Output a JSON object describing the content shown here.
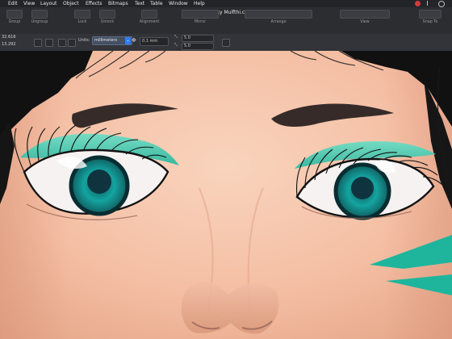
{
  "menubar": {
    "items": [
      "Edit",
      "View",
      "Layout",
      "Object",
      "Effects",
      "Bitmaps",
      "Text",
      "Table",
      "Window",
      "Help"
    ]
  },
  "window": {
    "title": "Zaky Mulfthi.cdr"
  },
  "toolbar": {
    "groups": [
      "Group",
      "Ungroup",
      "Lock",
      "Unlock",
      "Alignment",
      "Mirror",
      "Arrange",
      "View",
      "Snap To"
    ]
  },
  "propbar": {
    "x_coord": "32.616",
    "y_coord": "13.292",
    "units_label": "Units:",
    "units_value": "millimeters",
    "nudge_value": "0.1 mm",
    "dup_x": "5.0",
    "dup_y": "5.0"
  },
  "colors": {
    "skin": "#f6c7ac",
    "eyeshadow": "#5fd1b7",
    "iris": "#1aa7a1",
    "hair": "#151515"
  }
}
